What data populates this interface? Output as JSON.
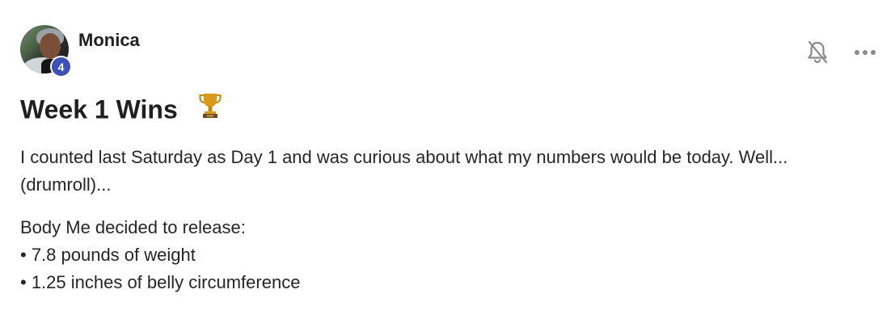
{
  "post": {
    "author": "Monica",
    "level": "4",
    "title": "Week 1 Wins",
    "title_emoji": "trophy-icon",
    "paragraph_1": "I counted last Saturday as Day 1 and was curious about what my numbers would be today. Well... (drumroll)...",
    "intro_line": "Body Me decided to release:",
    "bullets": [
      "• 7.8 pounds of weight",
      "• 1.25 inches of belly circumference"
    ]
  },
  "actions": {
    "notifications_icon": "bell-off-icon",
    "more_icon": "more-horizontal-icon"
  },
  "colors": {
    "badge": "#3f4fb8",
    "text": "#1f1f1f",
    "icon": "#8a8a8a",
    "trophy": "#c98a12"
  }
}
